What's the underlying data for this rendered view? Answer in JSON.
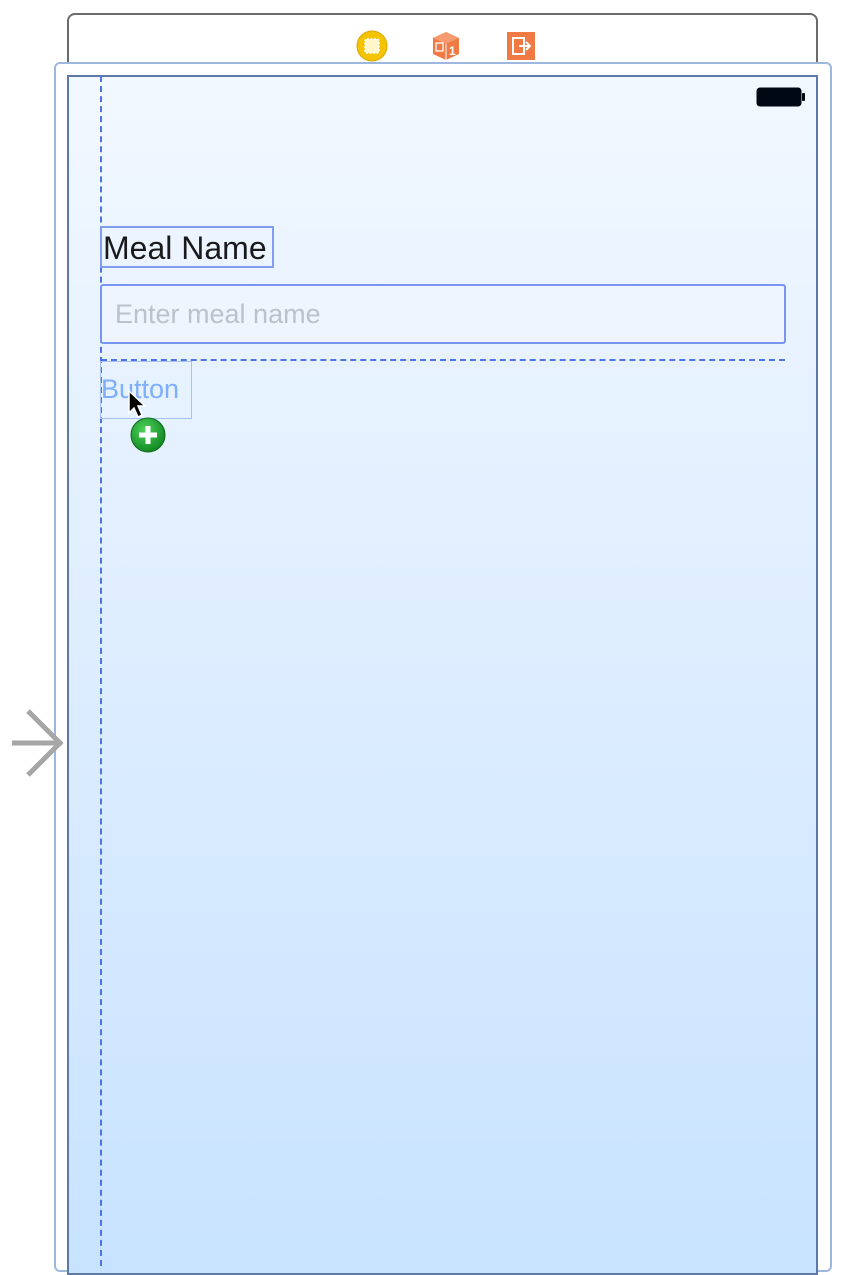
{
  "scene": {
    "dock_icons": [
      "view-controller-icon",
      "first-responder-icon",
      "exit-icon"
    ],
    "first_responder_badge": "1"
  },
  "status_bar": {
    "battery_icon": "battery-icon"
  },
  "content": {
    "label": {
      "text": "Meal Name"
    },
    "text_field": {
      "value": "",
      "placeholder": "Enter meal name"
    },
    "button": {
      "text": "Button"
    }
  },
  "colors": {
    "guide": "#4e73e4",
    "selection": "#7f9ef0",
    "button_text": "#7eaefc",
    "add_badge": "#1f9e2d",
    "view_controller_icon": "#f5c400",
    "first_responder_icon": "#f07a43",
    "exit_icon": "#f07a43"
  }
}
